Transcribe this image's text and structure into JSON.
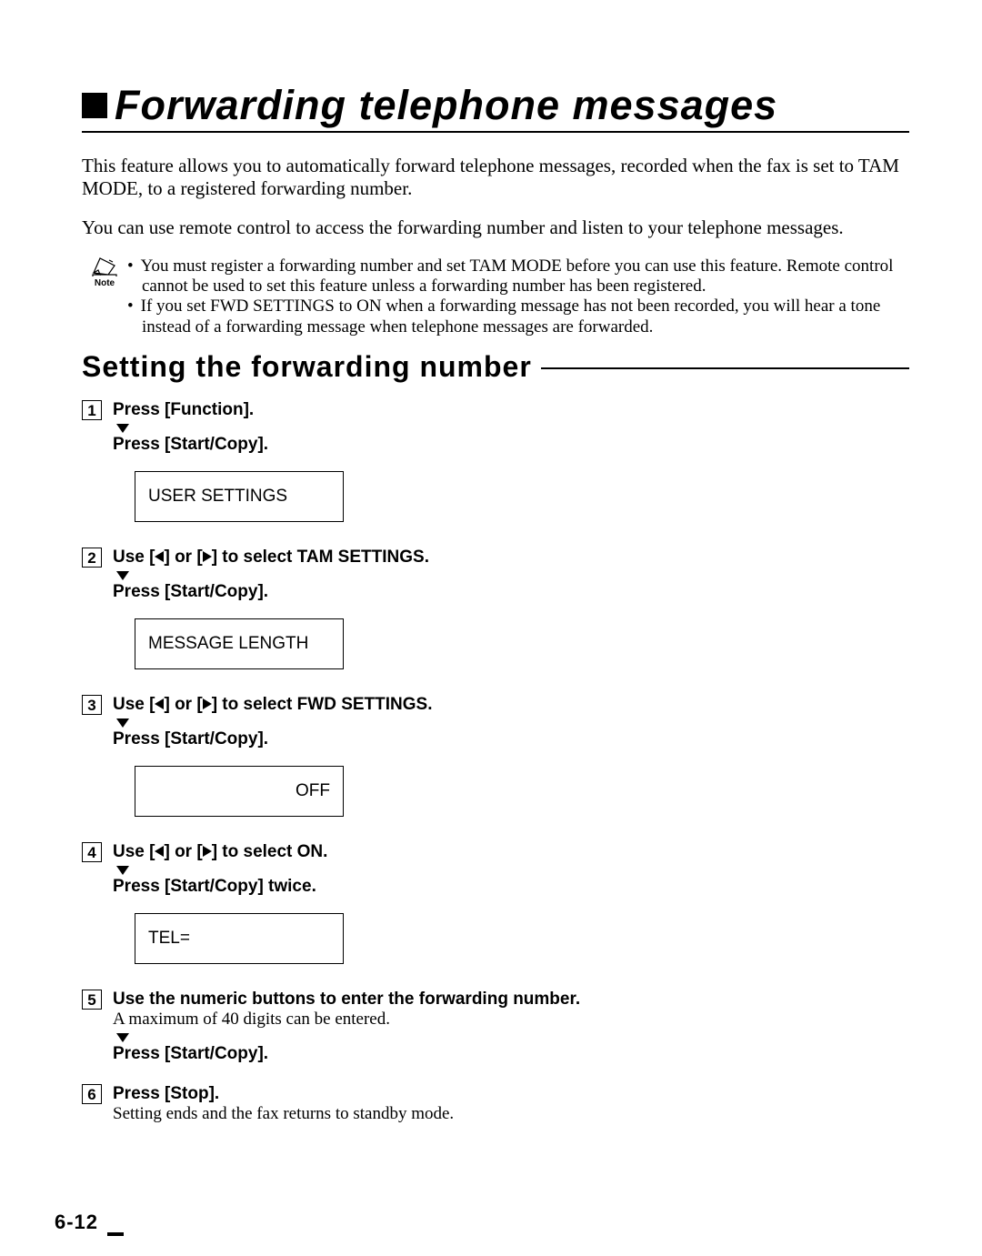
{
  "title": "Forwarding telephone messages",
  "intro1": "This feature allows you to automatically forward telephone messages, recorded when the fax is set to TAM MODE, to a registered forwarding number.",
  "intro2": "You can use remote control to access the forwarding number and listen to your telephone messages.",
  "note_label": "Note",
  "notes": {
    "0": "You must register a forwarding number and set TAM MODE before you can use this feature. Remote control cannot be used to set this feature unless a forwarding number has been registered.",
    "1": "If you set FWD SETTINGS to ON when a forwarding message has not been recorded, you will hear a tone instead of a forwarding message when telephone messages are forwarded."
  },
  "section_heading": "Setting the forwarding number",
  "steps": {
    "1": {
      "num": "1",
      "head_a": "Press [Function].",
      "sub": "Press [Start/Copy].",
      "display": "USER SETTINGS"
    },
    "2": {
      "num": "2",
      "head_pre": "Use [",
      "head_mid": "] or [",
      "head_post": "] to select TAM SETTINGS.",
      "sub": "Press [Start/Copy].",
      "display": "MESSAGE LENGTH"
    },
    "3": {
      "num": "3",
      "head_pre": "Use [",
      "head_mid": "] or [",
      "head_post": "] to select FWD SETTINGS.",
      "sub": "Press [Start/Copy].",
      "display": "OFF"
    },
    "4": {
      "num": "4",
      "head_pre": "Use [",
      "head_mid": "] or [",
      "head_post": "] to select ON.",
      "sub": "Press [Start/Copy] twice.",
      "display": "TEL="
    },
    "5": {
      "num": "5",
      "head": "Use the numeric buttons to enter the forwarding number.",
      "note": "A maximum of 40 digits can be entered.",
      "sub": "Press [Start/Copy]."
    },
    "6": {
      "num": "6",
      "head": "Press [Stop].",
      "note": "Setting ends and the fax returns to standby mode."
    }
  },
  "page_number": "6-12"
}
